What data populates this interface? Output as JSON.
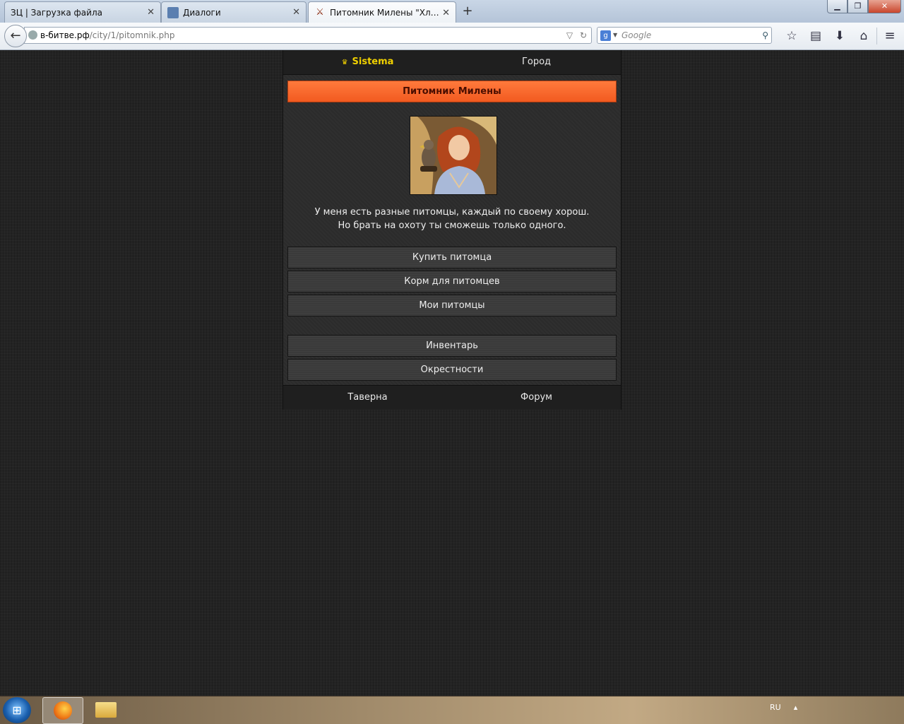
{
  "browser": {
    "tabs": [
      {
        "label": "ЗЦ | Загрузка файла",
        "active": false
      },
      {
        "label": "Диалоги",
        "active": false
      },
      {
        "label": "Питомник Милены \"Хлад...",
        "active": true
      }
    ],
    "url_host": "в-битве.рф",
    "url_path": "/city/1/pitomnik.php",
    "search_placeholder": "Google"
  },
  "game": {
    "top_nav": {
      "brand": "Sistema",
      "city": "Город"
    },
    "title": "Питомник Милены",
    "npc_text_line1": "У меня есть разные питомцы, каждый по своему хорош.",
    "npc_text_line2": "Но брать на охоту ты сможешь только одного.",
    "menu": [
      {
        "label": "Купить питомца"
      },
      {
        "label": "Корм для питомцев"
      },
      {
        "label": "Мои питомцы"
      }
    ],
    "menu2": [
      {
        "label": "Инвентарь"
      },
      {
        "label": "Окрестности"
      }
    ],
    "bottom_nav": {
      "tavern": "Таверна",
      "forum": "Форум"
    }
  },
  "taskbar": {
    "language": "RU"
  },
  "colors": {
    "accent_orange": "#f25a20",
    "brand_yellow": "#f0d000",
    "page_bg": "#232323"
  }
}
